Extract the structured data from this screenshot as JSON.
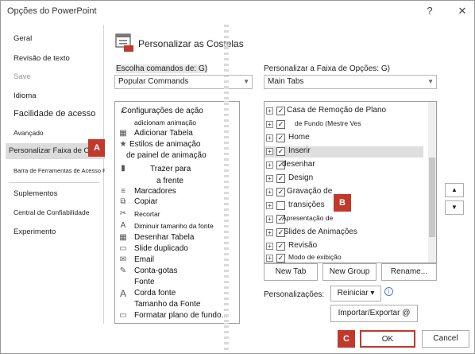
{
  "window": {
    "title": "Opções do PowerPoint",
    "help": "?",
    "close": "✕"
  },
  "sidebar": {
    "items": [
      {
        "label": "Geral",
        "size": "normal"
      },
      {
        "label": "Revisão de texto",
        "size": "normal"
      },
      {
        "label": "Save",
        "size": "dim"
      },
      {
        "label": "Idioma",
        "size": "normal"
      },
      {
        "label": "Facilidade de acesso",
        "size": "big"
      },
      {
        "label": "Avançado",
        "size": "small"
      },
      {
        "label": "Personalizar Faixa de Opções",
        "size": "sel"
      },
      {
        "label": "Barra de Ferramentas de Acesso Rápido",
        "size": "tiny"
      },
      {
        "label": "Suplementos",
        "size": "normal"
      },
      {
        "label": "Central de Confiabilidade",
        "size": "small"
      },
      {
        "label": "Experimento",
        "size": "normal"
      }
    ]
  },
  "header": {
    "title": "Personalizar as Costelas"
  },
  "left_panel": {
    "label": "Escolha comandos de: G)",
    "combo_value": "Popular Commands",
    "commands": [
      {
        "icon": "✓",
        "label": "Configurações de ação",
        "small": false
      },
      {
        "icon": "",
        "label": "adicionam animação",
        "small": true
      },
      {
        "icon": "▦",
        "label": "Adicionar Tabela",
        "small": false
      },
      {
        "icon": "★",
        "label": "Estilos de animação",
        "small": false
      },
      {
        "icon": "",
        "label": "de painel de animação",
        "small": false
      },
      {
        "icon": "▮",
        "label": "Trazer para",
        "small": false
      },
      {
        "icon": "",
        "label": "a frente",
        "small": false
      },
      {
        "icon": "≡",
        "label": "Marcadores",
        "small": false
      },
      {
        "icon": "⧉",
        "label": "Copiar",
        "small": false
      },
      {
        "icon": "✂",
        "label": "Recortar",
        "small": true
      },
      {
        "icon": "A",
        "label": "Diminuir tamanho da fonte",
        "small": true
      },
      {
        "icon": "▦",
        "label": "Desenhar Tabela",
        "small": false
      },
      {
        "icon": "▭",
        "label": "Slide duplicado",
        "small": false
      },
      {
        "icon": "✉",
        "label": "Email",
        "small": false
      },
      {
        "icon": "✎",
        "label": "Conta-gotas",
        "small": false
      },
      {
        "icon": "",
        "label": "Fonte",
        "small": false
      },
      {
        "icon": "A",
        "label": "Corda fonte",
        "small": false
      },
      {
        "icon": "",
        "label": "Tamanho da Fonte",
        "small": false
      },
      {
        "icon": "▭",
        "label": "Formatar plano de fundo...",
        "small": false
      }
    ]
  },
  "right_panel": {
    "label": "Personalizar a Faixa de Opções: G)",
    "combo_value": "Main Tabs",
    "tabs": [
      {
        "label": "Casa de Remoção de Plano",
        "checked": true,
        "indent": 0,
        "expander": "+"
      },
      {
        "label": "de Fundo (Mestre Ves",
        "checked": true,
        "indent": 1,
        "expander": "+",
        "small": true
      },
      {
        "label": "Home",
        "checked": true,
        "indent": 0,
        "expander": "+"
      },
      {
        "label": "Inserir",
        "checked": true,
        "indent": 0,
        "expander": "+",
        "selected": true
      },
      {
        "label": "desenhar",
        "checked": true,
        "indent": 0,
        "expander": "+"
      },
      {
        "label": "Design",
        "checked": true,
        "indent": 0,
        "expander": "+"
      },
      {
        "label": "Gravação de",
        "checked": true,
        "indent": 0,
        "expander": "+"
      },
      {
        "label": "transições",
        "checked": false,
        "indent": 0,
        "expander": "+"
      },
      {
        "label": "Apresentação de",
        "checked": true,
        "indent": 0,
        "expander": "+",
        "small": true
      },
      {
        "label": "Slides de Animações",
        "checked": true,
        "indent": 0,
        "expander": "+"
      },
      {
        "label": "Revisão",
        "checked": true,
        "indent": 0,
        "expander": "+"
      },
      {
        "label": "Modo de exibição",
        "checked": true,
        "indent": 0,
        "expander": "+",
        "small": true
      }
    ],
    "up_arrow": "▲",
    "down_arrow": "▼"
  },
  "buttons": {
    "new_tab": "New Tab",
    "new_group": "New Group",
    "rename": "Rename...",
    "personalizations_label": "Personalizações:",
    "reset": "Reiniciar",
    "reset_arrow": "▾",
    "info": "i",
    "import_export": "Importar/Exportar @",
    "ok": "OK",
    "cancel": "Cancel"
  },
  "badges": {
    "a": "A",
    "b": "B",
    "c": "C"
  },
  "colors": {
    "badge": "#c0392b",
    "ok_border": "#c0392b"
  }
}
